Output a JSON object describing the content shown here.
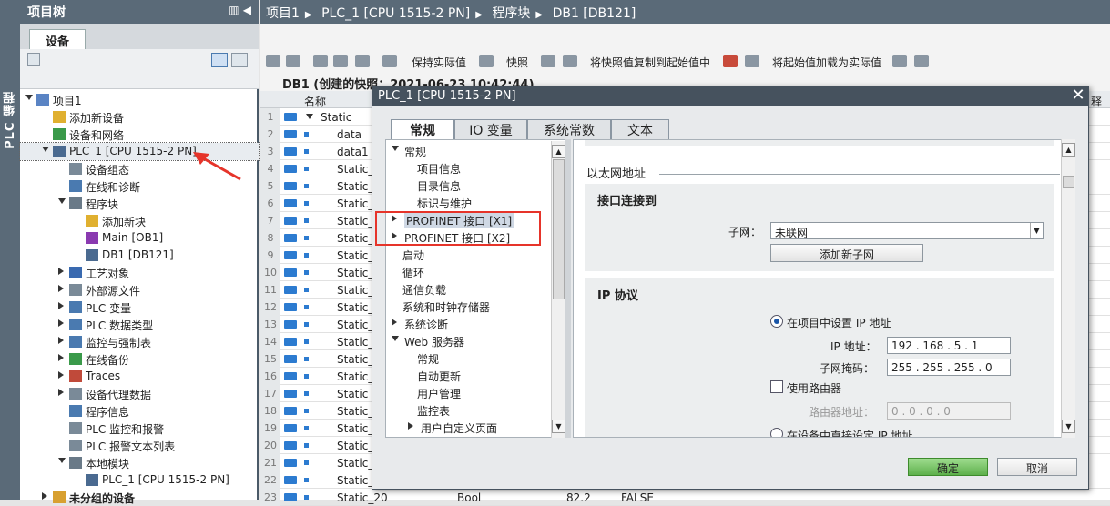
{
  "left_strip": {
    "label": "PLC 编程"
  },
  "tree": {
    "title": "项目树",
    "tab": "设备",
    "items": [
      {
        "label": "项目1"
      },
      {
        "label": "添加新设备"
      },
      {
        "label": "设备和网络"
      },
      {
        "label": "PLC_1 [CPU 1515-2 PN]"
      },
      {
        "label": "设备组态"
      },
      {
        "label": "在线和诊断"
      },
      {
        "label": "程序块"
      },
      {
        "label": "添加新块"
      },
      {
        "label": "Main [OB1]"
      },
      {
        "label": "DB1 [DB121]"
      },
      {
        "label": "工艺对象"
      },
      {
        "label": "外部源文件"
      },
      {
        "label": "PLC 变量"
      },
      {
        "label": "PLC 数据类型"
      },
      {
        "label": "监控与强制表"
      },
      {
        "label": "在线备份"
      },
      {
        "label": "Traces"
      },
      {
        "label": "设备代理数据"
      },
      {
        "label": "程序信息"
      },
      {
        "label": "PLC 监控和报警"
      },
      {
        "label": "PLC 报警文本列表"
      },
      {
        "label": "本地模块"
      },
      {
        "label": "PLC_1 [CPU 1515-2 PN]"
      },
      {
        "label": "未分组的设备"
      }
    ]
  },
  "breadcrumb": [
    "项目1",
    "PLC_1 [CPU 1515-2 PN]",
    "程序块",
    "DB1 [DB121]"
  ],
  "toolbar": {
    "keep_actual": "保持实际值",
    "snapshot": "快照",
    "copy_snapshot": "将快照值复制到起始值中",
    "load_start": "将起始值加载为实际值"
  },
  "editor": {
    "title": "DB1 (创建的快照：2021-06-23 10:42:44)",
    "col_name": "名称",
    "col_right": "释",
    "rows": [
      {
        "num": "1",
        "name": "Static"
      },
      {
        "num": "2",
        "name": "data"
      },
      {
        "num": "3",
        "name": "data1"
      },
      {
        "num": "4",
        "name": "Static_"
      },
      {
        "num": "5",
        "name": "Static_"
      },
      {
        "num": "6",
        "name": "Static_"
      },
      {
        "num": "7",
        "name": "Static_"
      },
      {
        "num": "8",
        "name": "Static_"
      },
      {
        "num": "9",
        "name": "Static_"
      },
      {
        "num": "10",
        "name": "Static_"
      },
      {
        "num": "11",
        "name": "Static_"
      },
      {
        "num": "12",
        "name": "Static_"
      },
      {
        "num": "13",
        "name": "Static_"
      },
      {
        "num": "14",
        "name": "Static_"
      },
      {
        "num": "15",
        "name": "Static_"
      },
      {
        "num": "16",
        "name": "Static_"
      },
      {
        "num": "17",
        "name": "Static_"
      },
      {
        "num": "18",
        "name": "Static_"
      },
      {
        "num": "19",
        "name": "Static_"
      },
      {
        "num": "20",
        "name": "Static_"
      },
      {
        "num": "21",
        "name": "Static_"
      },
      {
        "num": "22",
        "name": "Static_"
      },
      {
        "num": "23",
        "name": "Static_20",
        "type": "Bool",
        "offset": "82.2",
        "value": "FALSE"
      }
    ]
  },
  "dialog": {
    "title": "PLC_1 [CPU 1515-2 PN]",
    "close": "✕",
    "tabs": [
      "常规",
      "IO 变量",
      "系统常数",
      "文本"
    ],
    "nav": [
      {
        "label": "常规"
      },
      {
        "label": "项目信息"
      },
      {
        "label": "目录信息"
      },
      {
        "label": "标识与维护"
      },
      {
        "label": "PROFINET 接口 [X1]"
      },
      {
        "label": "PROFINET 接口 [X2]"
      },
      {
        "label": "启动"
      },
      {
        "label": "循环"
      },
      {
        "label": "通信负载"
      },
      {
        "label": "系统和时钟存储器"
      },
      {
        "label": "系统诊断"
      },
      {
        "label": "Web 服务器"
      },
      {
        "label": "常规"
      },
      {
        "label": "自动更新"
      },
      {
        "label": "用户管理"
      },
      {
        "label": "监控表"
      },
      {
        "label": "用户自定义页面"
      }
    ],
    "ethernet_heading": "以太网地址",
    "iface_heading": "接口连接到",
    "subnet_label": "子网：",
    "subnet_value": "未联网",
    "add_subnet": "添加新子网",
    "ip_heading": "IP 协议",
    "radio_set_in_project": "在项目中设置 IP 地址",
    "ip_label": "IP 地址：",
    "ip_value": "192 . 168 . 5   .  1",
    "mask_label": "子网掩码：",
    "mask_value": "255 . 255 . 255 . 0",
    "use_router": "使用路由器",
    "router_label": "路由器地址：",
    "router_value": "0   .  0   .  0   .  0",
    "radio_set_on_device": "在设备中直接设定 IP 地址",
    "ok": "确定",
    "cancel": "取消"
  }
}
